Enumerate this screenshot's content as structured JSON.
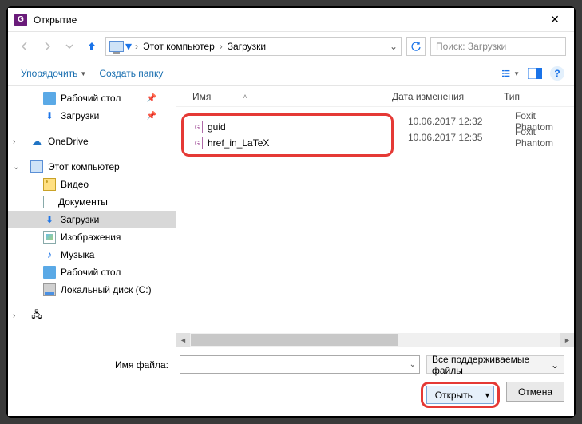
{
  "title": "Открытие",
  "breadcrumb": {
    "pc": "Этот компьютер",
    "folder": "Загрузки"
  },
  "search": {
    "placeholder": "Поиск: Загрузки"
  },
  "toolbar": {
    "organize": "Упорядочить",
    "newfolder": "Создать папку"
  },
  "sidebar": {
    "quick": {
      "desktop": "Рабочий стол",
      "downloads": "Загрузки"
    },
    "onedrive": "OneDrive",
    "thispc": "Этот компьютер",
    "items": {
      "video": "Видео",
      "documents": "Документы",
      "downloads": "Загрузки",
      "pictures": "Изображения",
      "music": "Музыка",
      "desktop": "Рабочий стол",
      "disk": "Локальный диск (C:)"
    }
  },
  "columns": {
    "name": "Имя",
    "date": "Дата изменения",
    "type": "Тип"
  },
  "files": [
    {
      "name": "guid",
      "date": "10.06.2017 12:32",
      "type": "Foxit Phantom"
    },
    {
      "name": "href_in_LaTeX",
      "date": "10.06.2017 12:35",
      "type": "Foxit Phantom"
    }
  ],
  "bottom": {
    "filename_label": "Имя файла:",
    "filter": "Все поддерживаемые файлы",
    "open": "Открыть",
    "cancel": "Отмена"
  }
}
